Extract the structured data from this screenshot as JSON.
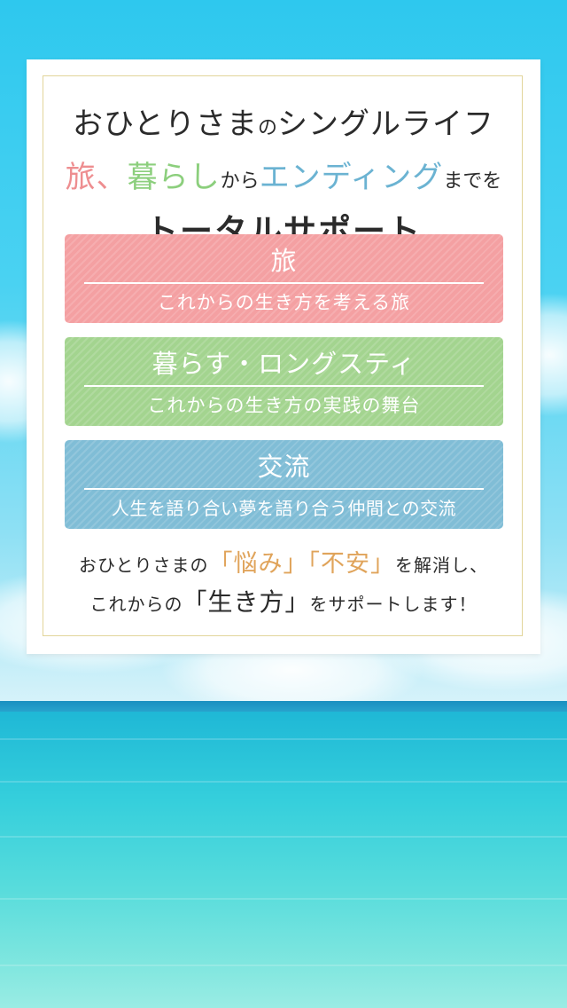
{
  "headline": {
    "line1_big": "おひとりさま",
    "line1_small": "の",
    "line1_big2": "シングルライフ",
    "line2_pink": "旅、",
    "line2_green": "暮らし",
    "line2_small1": "から",
    "line2_blue": "エンディング",
    "line2_small2": "までを",
    "line3": "トータルサポート"
  },
  "boxes": [
    {
      "title": "旅",
      "subtitle": "これからの生き方を考える旅",
      "color": "#f4a0a2"
    },
    {
      "title": "暮らす・ロングスティ",
      "subtitle": "これからの生き方の実践の舞台",
      "color": "#a3d48f"
    },
    {
      "title": "交流",
      "subtitle": "人生を語り合い夢を語り合う仲間との交流",
      "color": "#80bdd6"
    }
  ],
  "footer": {
    "line1_a": "おひとりさまの",
    "line1_hl1": "悩み",
    "line1_hl2": "不安",
    "line1_b": "を解消し、",
    "line2_a": "これからの",
    "line2_hl": "生き方",
    "line2_b": "をサポートします！"
  },
  "colors": {
    "pink": "#ee8e90",
    "green": "#8ccf7d",
    "blue": "#6bb3d2",
    "orange": "#e0a45b",
    "frame": "#e2d59a"
  }
}
